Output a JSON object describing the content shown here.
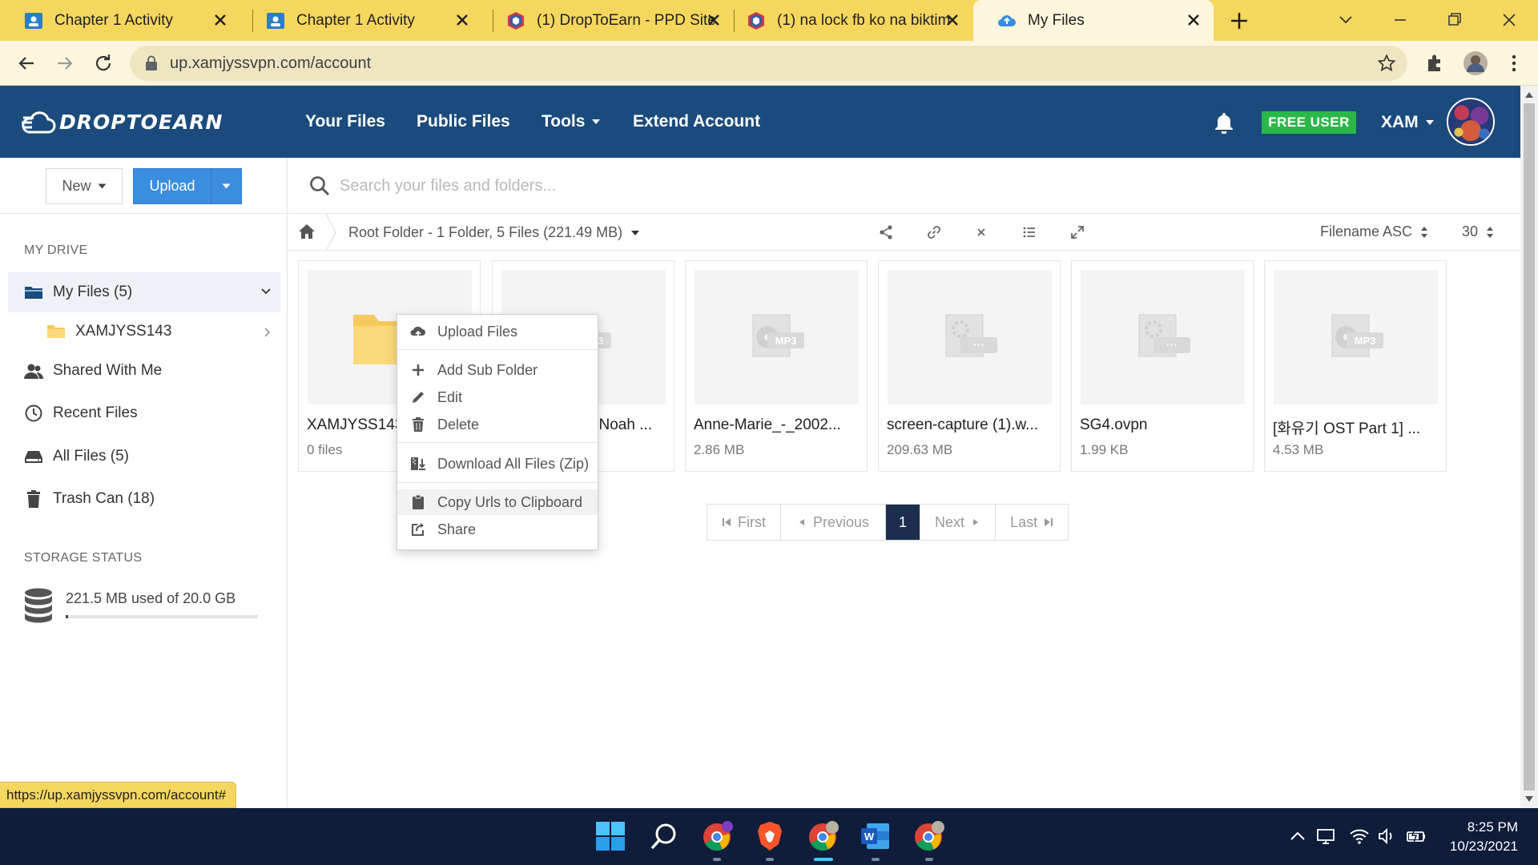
{
  "browser": {
    "tabs": [
      {
        "title": "Chapter 1 Activity",
        "icon": "classroom-icon",
        "active": false
      },
      {
        "title": "Chapter 1 Activity",
        "icon": "classroom-icon",
        "active": false
      },
      {
        "title": "(1) DropToEarn - PPD Site",
        "icon": "droptoearn-icon",
        "active": false
      },
      {
        "title": "(1) na lock fb ko na biktim",
        "icon": "droptoearn-icon",
        "active": false
      },
      {
        "title": "My Files",
        "icon": "cloud-icon",
        "active": true
      }
    ],
    "url": "up.xamjyssvpn.com/account",
    "status_url": "https://up.xamjyssvpn.com/account#"
  },
  "site": {
    "logo": "DROPTOEARN",
    "nav": {
      "your_files": "Your Files",
      "public_files": "Public Files",
      "tools": "Tools",
      "extend_account": "Extend Account"
    },
    "badge": "FREE USER",
    "user": "XAM",
    "accent": "#1b4b7c",
    "badge_color": "#2bb84a"
  },
  "sidebar": {
    "new_label": "New",
    "upload_label": "Upload",
    "my_drive_heading": "MY DRIVE",
    "my_files": "My Files (5)",
    "subfolder": "XAMJYSS143",
    "shared": "Shared With Me",
    "recent": "Recent Files",
    "all_files": "All Files (5)",
    "trash": "Trash Can (18)",
    "storage_heading": "STORAGE STATUS",
    "storage_text": "221.5 MB used of 20.0 GB",
    "storage_fraction": 0.011
  },
  "main": {
    "search_placeholder": "Search your files and folders...",
    "breadcrumb": "Root Folder - 1 Folder, 5 Files (221.49 MB)",
    "sort": "Filename ASC",
    "per_page": "30",
    "files": [
      {
        "name": "XAMJYSS143",
        "meta": "0 files",
        "type": "folder"
      },
      {
        "name": "Post Malone - Noah ...",
        "meta": "",
        "type": "mp3"
      },
      {
        "name": "Anne-Marie_-_2002...",
        "meta": "2.86 MB",
        "type": "mp3"
      },
      {
        "name": "screen-capture (1).w...",
        "meta": "209.63 MB",
        "type": "file"
      },
      {
        "name": "SG4.ovpn",
        "meta": "1.99 KB",
        "type": "file"
      },
      {
        "name": "[화유기 OST Part 1] ...",
        "meta": "4.53 MB",
        "type": "mp3"
      }
    ],
    "pager": {
      "first": "First",
      "previous": "Previous",
      "current": "1",
      "next": "Next",
      "last": "Last"
    }
  },
  "context_menu": {
    "upload": "Upload Files",
    "add_sub_folder": "Add Sub Folder",
    "edit": "Edit",
    "delete": "Delete",
    "download_all": "Download All Files (Zip)",
    "copy_urls": "Copy Urls to Clipboard",
    "share": "Share"
  },
  "taskbar": {
    "time": "8:25 PM",
    "date": "10/23/2021"
  }
}
